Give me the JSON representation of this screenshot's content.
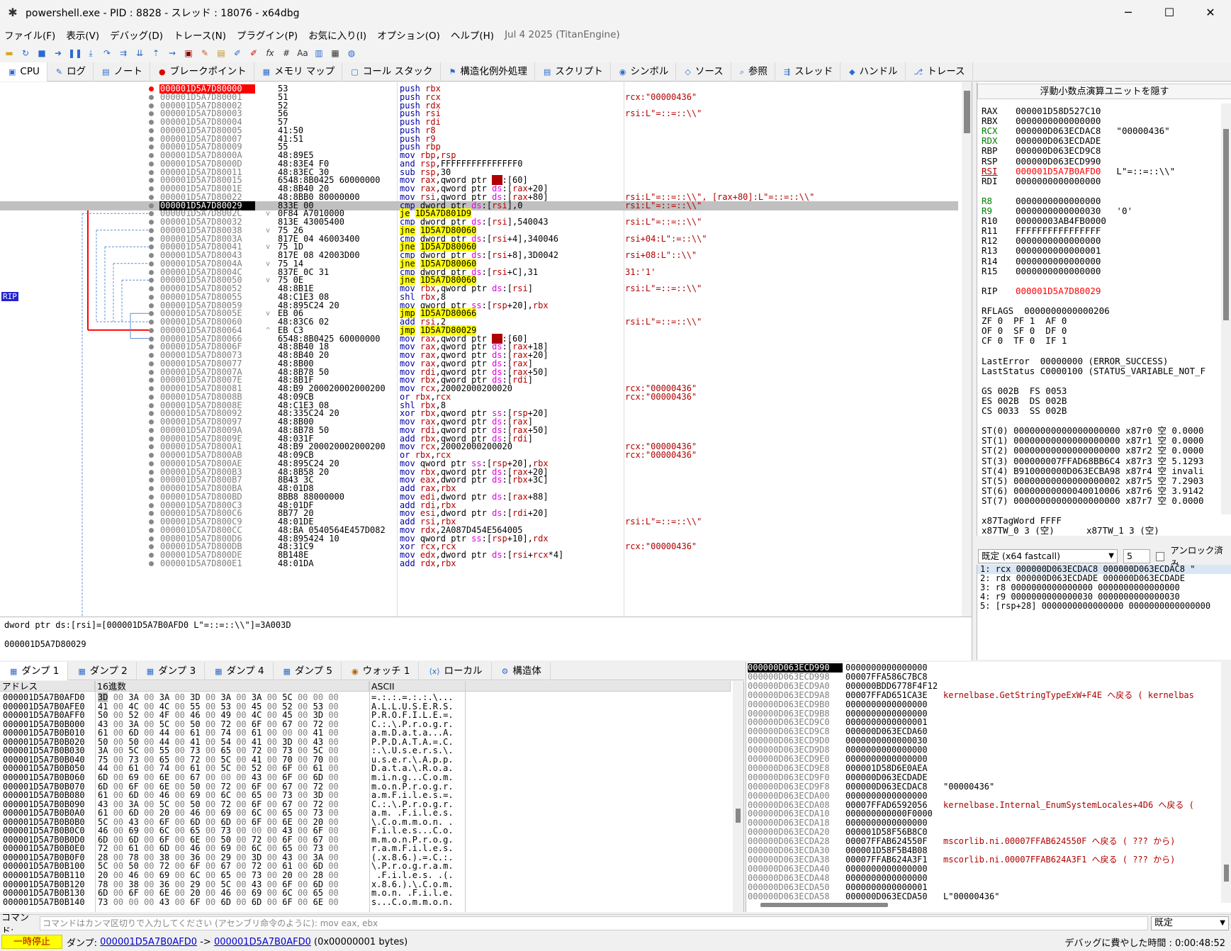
{
  "window": {
    "title": "powershell.exe - PID : 8828 - スレッド : 18076 - x64dbg",
    "minimize": "─",
    "maximize": "☐",
    "close": "✕"
  },
  "menu": [
    "ファイル(F)",
    "表示(V)",
    "デバッグ(D)",
    "トレース(N)",
    "プラグイン(P)",
    "お気に入り(I)",
    "オプション(O)",
    "ヘルプ(H)"
  ],
  "version": "Jul 4 2025 (TitanEngine)",
  "tabs": [
    "CPU",
    "ログ",
    "ノート",
    "ブレークポイント",
    "メモリ マップ",
    "コール スタック",
    "構造化例外処理",
    "スクリプト",
    "シンボル",
    "ソース",
    "参照",
    "スレッド",
    "ハンドル",
    "トレース"
  ],
  "rip_label": "RIP",
  "disasm": [
    {
      "addr": "000001D5A7D80000",
      "bytes": "53",
      "asm": "push rbx",
      "cmt": ""
    },
    {
      "addr": "000001D5A7D80001",
      "bytes": "51",
      "asm": "push rcx",
      "cmt": "rcx:\"00000436\""
    },
    {
      "addr": "000001D5A7D80002",
      "bytes": "52",
      "asm": "push rdx",
      "cmt": ""
    },
    {
      "addr": "000001D5A7D80003",
      "bytes": "56",
      "asm": "push rsi",
      "cmt": "rsi:L\"=::=::\\\\\""
    },
    {
      "addr": "000001D5A7D80004",
      "bytes": "57",
      "asm": "push rdi",
      "cmt": ""
    },
    {
      "addr": "000001D5A7D80005",
      "bytes": "41:50",
      "asm": "push r8",
      "cmt": ""
    },
    {
      "addr": "000001D5A7D80007",
      "bytes": "41:51",
      "asm": "push r9",
      "cmt": ""
    },
    {
      "addr": "000001D5A7D80009",
      "bytes": "55",
      "asm": "push rbp",
      "cmt": ""
    },
    {
      "addr": "000001D5A7D8000A",
      "bytes": "48:89E5",
      "asm": "mov rbp,rsp",
      "cmt": ""
    },
    {
      "addr": "000001D5A7D8000D",
      "bytes": "48:83E4 F0",
      "asm": "and rsp,FFFFFFFFFFFFFFF0",
      "cmt": ""
    },
    {
      "addr": "000001D5A7D80011",
      "bytes": "48:83EC 30",
      "asm": "sub rsp,30",
      "cmt": ""
    },
    {
      "addr": "000001D5A7D80015",
      "bytes": "6548:8B0425 60000000",
      "asm": "mov rax,qword ptr gs:[60]",
      "cmt": ""
    },
    {
      "addr": "000001D5A7D8001E",
      "bytes": "48:8B40 20",
      "asm": "mov rax,qword ptr ds:[rax+20]",
      "cmt": ""
    },
    {
      "addr": "000001D5A7D80022",
      "bytes": "48:8BB0 80000000",
      "asm": "mov rsi,qword ptr ds:[rax+80]",
      "cmt": "rsi:L\"=::=::\\\\\", [rax+80]:L\"=::=::\\\\\""
    },
    {
      "addr": "000001D5A7D80029",
      "bytes": "833E 00",
      "asm": "cmp dword ptr ds:[rsi],0",
      "cmt": "rsi:L\"=::=::\\\\\""
    },
    {
      "addr": "000001D5A7D8002C",
      "bytes": "0F84 A7010000",
      "asm": "je 1D5A7D801D9",
      "cmt": ""
    },
    {
      "addr": "000001D5A7D80032",
      "bytes": "813E 43005400",
      "asm": "cmp dword ptr ds:[rsi],540043",
      "cmt": "rsi:L\"=::=::\\\\\""
    },
    {
      "addr": "000001D5A7D80038",
      "bytes": "75 26",
      "asm": "jne 1D5A7D80060",
      "cmt": ""
    },
    {
      "addr": "000001D5A7D8003A",
      "bytes": "817E 04 46003400",
      "asm": "cmp dword ptr ds:[rsi+4],340046",
      "cmt": "rsi+04:L\":=::\\\\\""
    },
    {
      "addr": "000001D5A7D80041",
      "bytes": "75 1D",
      "asm": "jne 1D5A7D80060",
      "cmt": ""
    },
    {
      "addr": "000001D5A7D80043",
      "bytes": "817E 08 42003D00",
      "asm": "cmp dword ptr ds:[rsi+8],3D0042",
      "cmt": "rsi+08:L\"::\\\\\""
    },
    {
      "addr": "000001D5A7D8004A",
      "bytes": "75 14",
      "asm": "jne 1D5A7D80060",
      "cmt": ""
    },
    {
      "addr": "000001D5A7D8004C",
      "bytes": "837E 0C 31",
      "asm": "cmp dword ptr ds:[rsi+C],31",
      "cmt": "31:'1'"
    },
    {
      "addr": "000001D5A7D80050",
      "bytes": "75 0E",
      "asm": "jne 1D5A7D80060",
      "cmt": ""
    },
    {
      "addr": "000001D5A7D80052",
      "bytes": "48:8B1E",
      "asm": "mov rbx,qword ptr ds:[rsi]",
      "cmt": "rsi:L\"=::=::\\\\\""
    },
    {
      "addr": "000001D5A7D80055",
      "bytes": "48:C1E3 08",
      "asm": "shl rbx,8",
      "cmt": ""
    },
    {
      "addr": "000001D5A7D80059",
      "bytes": "48:895C24 20",
      "asm": "mov qword ptr ss:[rsp+20],rbx",
      "cmt": ""
    },
    {
      "addr": "000001D5A7D8005E",
      "bytes": "EB 06",
      "asm": "jmp 1D5A7D80066",
      "cmt": ""
    },
    {
      "addr": "000001D5A7D80060",
      "bytes": "48:83C6 02",
      "asm": "add rsi,2",
      "cmt": "rsi:L\"=::=::\\\\\""
    },
    {
      "addr": "000001D5A7D80064",
      "bytes": "EB C3",
      "asm": "jmp 1D5A7D80029",
      "cmt": ""
    },
    {
      "addr": "000001D5A7D80066",
      "bytes": "6548:8B0425 60000000",
      "asm": "mov rax,qword ptr gs:[60]",
      "cmt": ""
    },
    {
      "addr": "000001D5A7D8006F",
      "bytes": "48:8B40 18",
      "asm": "mov rax,qword ptr ds:[rax+18]",
      "cmt": ""
    },
    {
      "addr": "000001D5A7D80073",
      "bytes": "48:8B40 20",
      "asm": "mov rax,qword ptr ds:[rax+20]",
      "cmt": ""
    },
    {
      "addr": "000001D5A7D80077",
      "bytes": "48:8B00",
      "asm": "mov rax,qword ptr ds:[rax]",
      "cmt": ""
    },
    {
      "addr": "000001D5A7D8007A",
      "bytes": "48:8B78 50",
      "asm": "mov rdi,qword ptr ds:[rax+50]",
      "cmt": ""
    },
    {
      "addr": "000001D5A7D8007E",
      "bytes": "48:8B1F",
      "asm": "mov rbx,qword ptr ds:[rdi]",
      "cmt": ""
    },
    {
      "addr": "000001D5A7D80081",
      "bytes": "48:B9 200020002000200",
      "asm": "mov rcx,20002000200020",
      "cmt": "rcx:\"00000436\""
    },
    {
      "addr": "000001D5A7D8008B",
      "bytes": "48:09CB",
      "asm": "or rbx,rcx",
      "cmt": "rcx:\"00000436\""
    },
    {
      "addr": "000001D5A7D8008E",
      "bytes": "48:C1E3 08",
      "asm": "shl rbx,8",
      "cmt": ""
    },
    {
      "addr": "000001D5A7D80092",
      "bytes": "48:335C24 20",
      "asm": "xor rbx,qword ptr ss:[rsp+20]",
      "cmt": ""
    },
    {
      "addr": "000001D5A7D80097",
      "bytes": "48:8B00",
      "asm": "mov rax,qword ptr ds:[rax]",
      "cmt": ""
    },
    {
      "addr": "000001D5A7D8009A",
      "bytes": "48:8B78 50",
      "asm": "mov rdi,qword ptr ds:[rax+50]",
      "cmt": ""
    },
    {
      "addr": "000001D5A7D8009E",
      "bytes": "48:031F",
      "asm": "add rbx,qword ptr ds:[rdi]",
      "cmt": ""
    },
    {
      "addr": "000001D5A7D800A1",
      "bytes": "48:B9 200020002000200",
      "asm": "mov rcx,20002000200020",
      "cmt": "rcx:\"00000436\""
    },
    {
      "addr": "000001D5A7D800AB",
      "bytes": "48:09CB",
      "asm": "or rbx,rcx",
      "cmt": "rcx:\"00000436\""
    },
    {
      "addr": "000001D5A7D800AE",
      "bytes": "48:895C24 20",
      "asm": "mov qword ptr ss:[rsp+20],rbx",
      "cmt": ""
    },
    {
      "addr": "000001D5A7D800B3",
      "bytes": "48:8B58 20",
      "asm": "mov rbx,qword ptr ds:[rax+20]",
      "cmt": ""
    },
    {
      "addr": "000001D5A7D800B7",
      "bytes": "8B43 3C",
      "asm": "mov eax,dword ptr ds:[rbx+3C]",
      "cmt": ""
    },
    {
      "addr": "000001D5A7D800BA",
      "bytes": "48:01D8",
      "asm": "add rax,rbx",
      "cmt": ""
    },
    {
      "addr": "000001D5A7D800BD",
      "bytes": "8BB8 88000000",
      "asm": "mov edi,dword ptr ds:[rax+88]",
      "cmt": ""
    },
    {
      "addr": "000001D5A7D800C3",
      "bytes": "48:01DF",
      "asm": "add rdi,rbx",
      "cmt": ""
    },
    {
      "addr": "000001D5A7D800C6",
      "bytes": "8B77 20",
      "asm": "mov esi,dword ptr ds:[rdi+20]",
      "cmt": ""
    },
    {
      "addr": "000001D5A7D800C9",
      "bytes": "48:01DE",
      "asm": "add rsi,rbx",
      "cmt": "rsi:L\"=::=::\\\\\""
    },
    {
      "addr": "000001D5A7D800CC",
      "bytes": "48:BA 0540564E457D082",
      "asm": "mov rdx,2A087D454E564005",
      "cmt": ""
    },
    {
      "addr": "000001D5A7D800D6",
      "bytes": "48:895424 10",
      "asm": "mov qword ptr ss:[rsp+10],rdx",
      "cmt": ""
    },
    {
      "addr": "000001D5A7D800DB",
      "bytes": "48:31C9",
      "asm": "xor rcx,rcx",
      "cmt": "rcx:\"00000436\""
    },
    {
      "addr": "000001D5A7D800DE",
      "bytes": "8B148E",
      "asm": "mov edx,dword ptr ds:[rsi+rcx*4]",
      "cmt": ""
    },
    {
      "addr": "000001D5A7D800E1",
      "bytes": "48:01DA",
      "asm": "add rdx,rbx",
      "cmt": ""
    }
  ],
  "info_line1": "dword ptr ds:[rsi]=[000001D5A7B0AFD0 L\"=::=::\\\\\"]=3A003D",
  "info_line2": "000001D5A7D80029",
  "regs_hide_button": "浮動小数点演算ユニットを隠す",
  "registers": [
    {
      "n": "RAX",
      "v": "000001D58D527C10",
      "c": ""
    },
    {
      "n": "RBX",
      "v": "0000000000000000",
      "c": ""
    },
    {
      "n": "RCX",
      "v": "000000D063ECDAC8",
      "c": "\"00000436\""
    },
    {
      "n": "RDX",
      "v": "000000D063ECDADE",
      "c": ""
    },
    {
      "n": "RBP",
      "v": "000000D063ECD9C8",
      "c": ""
    },
    {
      "n": "RSP",
      "v": "000000D063ECD990",
      "c": ""
    },
    {
      "n": "RSI",
      "v": "000001D5A7B0AFD0",
      "c": "L\"=::=::\\\\\""
    },
    {
      "n": "RDI",
      "v": "0000000000000000",
      "c": ""
    },
    {
      "n": "R8",
      "v": "0000000000000000",
      "c": ""
    },
    {
      "n": "R9",
      "v": "0000000000000030",
      "c": "'0'"
    },
    {
      "n": "R10",
      "v": "00000003AB4FB0000",
      "c": ""
    },
    {
      "n": "R11",
      "v": "FFFFFFFFFFFFFFFF",
      "c": ""
    },
    {
      "n": "R12",
      "v": "0000000000000000",
      "c": ""
    },
    {
      "n": "R13",
      "v": "0000000000000001",
      "c": ""
    },
    {
      "n": "R14",
      "v": "0000000000000000",
      "c": ""
    },
    {
      "n": "R15",
      "v": "0000000000000000",
      "c": ""
    },
    {
      "n": "RIP",
      "v": "000001D5A7D80029",
      "c": ""
    }
  ],
  "rflags_line": "RFLAGS  0000000000000206",
  "flags_lines": [
    "ZF 0  PF 1  AF 0",
    "OF 0  SF 0  DF 0",
    "CF 0  TF 0  IF 1"
  ],
  "lasterror": "LastError  00000000 (ERROR_SUCCESS)",
  "laststatus": "LastStatus C0000100 (STATUS_VARIABLE_NOT_F",
  "segs": [
    "GS 002B  FS 0053",
    "ES 002B  DS 002B",
    "CS 0033  SS 002B"
  ],
  "fpu": [
    "ST(0) 00000000000000000000 x87r0 空 0.0000",
    "ST(1) 00000000000000000000 x87r1 空 0.0000",
    "ST(2) 00000000000000000000 x87r2 空 0.0000",
    "ST(3) 000000007FFAD68BB6C4 x87r3 空 5.1293",
    "ST(4) B910000000D063ECBA98 x87r4 空 invali",
    "ST(5) 00000000000000000002 x87r5 空 7.2903",
    "ST(6) 00000000000040010006 x87r6 空 3.9142",
    "ST(7) 00000000000000000000 x87r7 空 0.0000"
  ],
  "tagword": "x87TagWord FFFF",
  "tw_line": "x87TW_0 3 (空)      x87TW_1 3 (空)",
  "callconv": {
    "selected": "既定 (x64 fastcall)",
    "count": "5",
    "unlock_label": "アンロック済み"
  },
  "args": [
    "1: rcx 000000D063ECDAC8 000000D063ECDAC8 \"",
    "2: rdx 000000D063ECDADE 000000D063ECDADE",
    "3: r8 0000000000000000 0000000000000000",
    "4: r9 0000000000000030 0000000000000030",
    "5: [rsp+28] 0000000000000000 0000000000000000"
  ],
  "dump_tabs": [
    "ダンプ 1",
    "ダンプ 2",
    "ダンプ 3",
    "ダンプ 4",
    "ダンプ 5",
    "ウォッチ 1",
    "ローカル",
    "構造体"
  ],
  "dump_headers": {
    "addr": "アドレス",
    "hex": "16進数",
    "ascii": "ASCII"
  },
  "dump_rows": [
    {
      "a": "000001D5A7B0AFD0",
      "h": "3D 00 3A 00 3A 00 3D 00 3A 00 3A 00 5C 00 00 00",
      "s": "=.:.:.=.:.:.\\..."
    },
    {
      "a": "000001D5A7B0AFE0",
      "h": "41 00 4C 00 4C 00 55 00 53 00 45 00 52 00 53 00",
      "s": "A.L.L.U.S.E.R.S."
    },
    {
      "a": "000001D5A7B0AFF0",
      "h": "50 00 52 00 4F 00 46 00 49 00 4C 00 45 00 3D 00",
      "s": "P.R.O.F.I.L.E.=."
    },
    {
      "a": "000001D5A7B0B000",
      "h": "43 00 3A 00 5C 00 50 00 72 00 6F 00 67 00 72 00",
      "s": "C.:.\\.P.r.o.g.r."
    },
    {
      "a": "000001D5A7B0B010",
      "h": "61 00 6D 00 44 00 61 00 74 00 61 00 00 00 41 00",
      "s": "a.m.D.a.t.a...A."
    },
    {
      "a": "000001D5A7B0B020",
      "h": "50 00 50 00 44 00 41 00 54 00 41 00 3D 00 43 00",
      "s": "P.P.D.A.T.A.=.C."
    },
    {
      "a": "000001D5A7B0B030",
      "h": "3A 00 5C 00 55 00 73 00 65 00 72 00 73 00 5C 00",
      "s": ":.\\.U.s.e.r.s.\\."
    },
    {
      "a": "000001D5A7B0B040",
      "h": "75 00 73 00 65 00 72 00 5C 00 41 00 70 00 70 00",
      "s": "u.s.e.r.\\.A.p.p."
    },
    {
      "a": "000001D5A7B0B050",
      "h": "44 00 61 00 74 00 61 00 5C 00 52 00 6F 00 61 00",
      "s": "D.a.t.a.\\.R.o.a."
    },
    {
      "a": "000001D5A7B0B060",
      "h": "6D 00 69 00 6E 00 67 00 00 00 43 00 6F 00 6D 00",
      "s": "m.i.n.g...C.o.m."
    },
    {
      "a": "000001D5A7B0B070",
      "h": "6D 00 6F 00 6E 00 50 00 72 00 6F 00 67 00 72 00",
      "s": "m.o.n.P.r.o.g.r."
    },
    {
      "a": "000001D5A7B0B080",
      "h": "61 00 6D 00 46 00 69 00 6C 00 65 00 73 00 3D 00",
      "s": "a.m.F.i.l.e.s.=."
    },
    {
      "a": "000001D5A7B0B090",
      "h": "43 00 3A 00 5C 00 50 00 72 00 6F 00 67 00 72 00",
      "s": "C.:.\\.P.r.o.g.r."
    },
    {
      "a": "000001D5A7B0B0A0",
      "h": "61 00 6D 00 20 00 46 00 69 00 6C 00 65 00 73 00",
      "s": "a.m. .F.i.l.e.s."
    },
    {
      "a": "000001D5A7B0B0B0",
      "h": "5C 00 43 00 6F 00 6D 00 6D 00 6F 00 6E 00 20 00",
      "s": "\\.C.o.m.m.o.n. ."
    },
    {
      "a": "000001D5A7B0B0C0",
      "h": "46 00 69 00 6C 00 65 00 73 00 00 00 43 00 6F 00",
      "s": "F.i.l.e.s...C.o."
    },
    {
      "a": "000001D5A7B0B0D0",
      "h": "6D 00 6D 00 6F 00 6E 00 50 00 72 00 6F 00 67 00",
      "s": "m.m.o.n.P.r.o.g."
    },
    {
      "a": "000001D5A7B0B0E0",
      "h": "72 00 61 00 6D 00 46 00 69 00 6C 00 65 00 73 00",
      "s": "r.a.m.F.i.l.e.s."
    },
    {
      "a": "000001D5A7B0B0F0",
      "h": "28 00 78 00 38 00 36 00 29 00 3D 00 43 00 3A 00",
      "s": "(.x.8.6.).=.C.:."
    },
    {
      "a": "000001D5A7B0B100",
      "h": "5C 00 50 00 72 00 6F 00 67 00 72 00 61 00 6D 00",
      "s": "\\.P.r.o.g.r.a.m."
    },
    {
      "a": "000001D5A7B0B110",
      "h": "20 00 46 00 69 00 6C 00 65 00 73 00 20 00 28 00",
      "s": " .F.i.l.e.s. .(."
    },
    {
      "a": "000001D5A7B0B120",
      "h": "78 00 38 00 36 00 29 00 5C 00 43 00 6F 00 6D 00",
      "s": "x.8.6.).\\.C.o.m."
    },
    {
      "a": "000001D5A7B0B130",
      "h": "6D 00 6F 00 6E 00 20 00 46 00 69 00 6C 00 65 00",
      "s": "m.o.n. .F.i.l.e."
    },
    {
      "a": "000001D5A7B0B140",
      "h": "73 00 00 00 43 00 6F 00 6D 00 6D 00 6F 00 6E 00",
      "s": "s...C.o.m.m.o.n."
    }
  ],
  "stack": [
    {
      "a": "000000D063ECD990",
      "v": "0000000000000000",
      "c": "",
      "plain": false
    },
    {
      "a": "000000D063ECD998",
      "v": "00007FFA586C7BC8",
      "c": "",
      "plain": false
    },
    {
      "a": "000000D063ECD9A0",
      "v": "000000BDD6778F4F12",
      "c": "",
      "plain": false
    },
    {
      "a": "000000D063ECD9A8",
      "v": "00007FFAD651CA3E",
      "c": "kernelbase.GetStringTypeExW+F4E へ戻る ( kernelbas",
      "plain": false
    },
    {
      "a": "000000D063ECD9B0",
      "v": "0000000000000000",
      "c": "",
      "plain": false
    },
    {
      "a": "000000D063ECD9B8",
      "v": "0000000000000000",
      "c": "",
      "plain": false
    },
    {
      "a": "000000D063ECD9C0",
      "v": "0000000000000001",
      "c": "",
      "plain": false
    },
    {
      "a": "000000D063ECD9C8",
      "v": "000000D063ECDA60",
      "c": "",
      "plain": false
    },
    {
      "a": "000000D063ECD9D0",
      "v": "0000000000000030",
      "c": "",
      "plain": false
    },
    {
      "a": "000000D063ECD9D8",
      "v": "0000000000000000",
      "c": "",
      "plain": false
    },
    {
      "a": "000000D063ECD9E0",
      "v": "0000000000000000",
      "c": "",
      "plain": false
    },
    {
      "a": "000000D063ECD9E8",
      "v": "000001D58D6E0AEA",
      "c": "",
      "plain": false
    },
    {
      "a": "000000D063ECD9F0",
      "v": "000000D063ECDADE",
      "c": "",
      "plain": false
    },
    {
      "a": "000000D063ECD9F8",
      "v": "000000D063ECDAC8",
      "c": "\"00000436\"",
      "plain": true
    },
    {
      "a": "000000D063ECDA00",
      "v": "0000000000000000",
      "c": "",
      "plain": false
    },
    {
      "a": "000000D063ECDA08",
      "v": "00007FFAD6592056",
      "c": "kernelbase.Internal_EnumSystemLocales+4D6 へ戻る (",
      "plain": false
    },
    {
      "a": "000000D063ECDA10",
      "v": "000000000000F0000",
      "c": "",
      "plain": false
    },
    {
      "a": "000000D063ECDA18",
      "v": "0000000000000000",
      "c": "",
      "plain": false
    },
    {
      "a": "000000D063ECDA20",
      "v": "000001D58F56B8C0",
      "c": "",
      "plain": false
    },
    {
      "a": "000000D063ECDA28",
      "v": "00007FFAB624550F",
      "c": "mscorlib.ni.00007FFAB624550F へ戻る ( ??? から)",
      "plain": false
    },
    {
      "a": "000000D063ECDA30",
      "v": "000001D58F5B4B08",
      "c": "",
      "plain": false
    },
    {
      "a": "000000D063ECDA38",
      "v": "00007FFAB624A3F1",
      "c": "mscorlib.ni.00007FFAB624A3F1 へ戻る ( ??? から)",
      "plain": false
    },
    {
      "a": "000000D063ECDA40",
      "v": "0000000000000000",
      "c": "",
      "plain": false
    },
    {
      "a": "000000D063ECDA48",
      "v": "0000000000000000",
      "c": "",
      "plain": false
    },
    {
      "a": "000000D063ECDA50",
      "v": "0000000000000001",
      "c": "",
      "plain": false
    },
    {
      "a": "000000D063ECDA58",
      "v": "000000D063ECDA50",
      "c": "L\"00000436\"",
      "plain": true
    }
  ],
  "command": {
    "label": "コマンド:",
    "placeholder": "コマンドはカンマ区切りで入力してください (アセンブリ命令のように): mov eax, ebx",
    "mode": "既定"
  },
  "status": {
    "state": "一時停止",
    "dump_label": "ダンプ:",
    "from": "000001D5A7B0AFD0",
    "arrow": "->",
    "to": "000001D5A7B0AFD0",
    "size": "(0x00000001 bytes)",
    "elapsed": "デバッグに費やした時間 : 0:00:48:52"
  }
}
